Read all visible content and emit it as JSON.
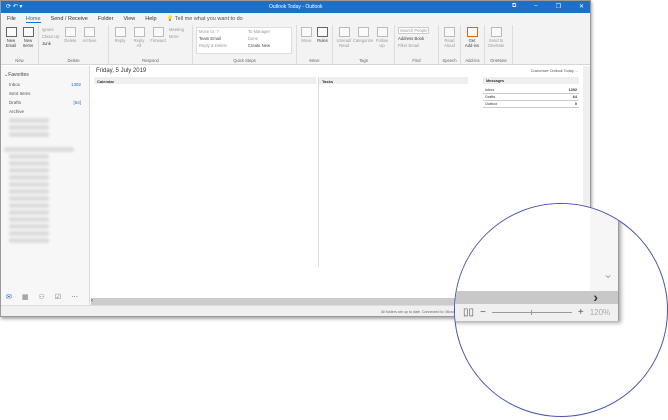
{
  "window": {
    "title": "Outlook Today - Outlook",
    "controls": [
      "⧉",
      "–",
      "❐",
      "✕"
    ]
  },
  "tabs": [
    "File",
    "Home",
    "Send / Receive",
    "Folder",
    "View",
    "Help"
  ],
  "active_tab": "Home",
  "tell_me": "Tell me what you want to do",
  "ribbon": {
    "new": {
      "label": "New",
      "buttons": [
        "New Email",
        "New Items"
      ]
    },
    "delete": {
      "label": "Delete",
      "small": [
        "Ignore",
        "Clean Up",
        "Junk"
      ],
      "buttons": [
        "Delete",
        "Archive"
      ]
    },
    "respond": {
      "label": "Respond",
      "buttons": [
        "Reply",
        "Reply All",
        "Forward"
      ],
      "small": [
        "Meeting",
        "More"
      ]
    },
    "quick_steps": {
      "label": "Quick Steps",
      "items": [
        "Move to: ?",
        "Team Email",
        "Reply & Delete",
        "To Manager",
        "Done",
        "Create New"
      ]
    },
    "move": {
      "label": "Move",
      "buttons": [
        "Move",
        "Rules"
      ]
    },
    "tags": {
      "label": "Tags",
      "buttons": [
        "Unread/ Read",
        "Categorize",
        "Follow Up"
      ]
    },
    "find": {
      "label": "Find",
      "search": "Search People",
      "items": [
        "Address Book",
        "Filter Email"
      ]
    },
    "speech": {
      "label": "Speech",
      "buttons": [
        "Read Aloud"
      ]
    },
    "addins": {
      "label": "Add-ins",
      "buttons": [
        "Get Add-ins"
      ]
    },
    "onenote": {
      "label": "OneNote",
      "buttons": [
        "Send to OneNote"
      ]
    }
  },
  "nav": {
    "favorites": "Favorites",
    "items": [
      {
        "label": "Inbox",
        "count": "1392"
      },
      {
        "label": "Sent Items",
        "count": ""
      },
      {
        "label": "Drafts",
        "count": "[64]"
      },
      {
        "label": "Archive",
        "count": ""
      }
    ]
  },
  "main": {
    "date": "Friday, 5 July 2019",
    "customize": "Customize Outlook Today ...",
    "calendar": "Calendar",
    "tasks": "Tasks",
    "messages": {
      "title": "Messages",
      "rows": [
        {
          "label": "Inbox",
          "value": "1392"
        },
        {
          "label": "Drafts",
          "value": "64"
        },
        {
          "label": "Outbox",
          "value": "0"
        }
      ]
    }
  },
  "status": {
    "text": "All folders are up to date.   Connected to: Microsoft Exchange",
    "zoom": "120%"
  }
}
